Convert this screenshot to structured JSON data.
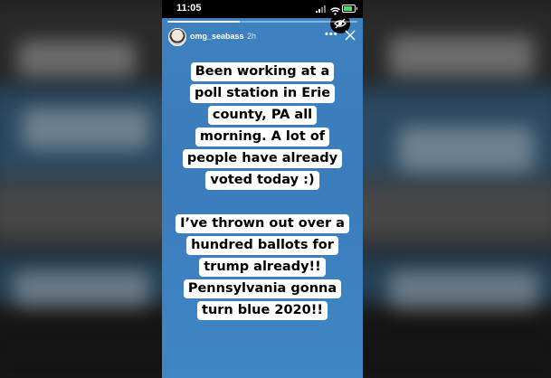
{
  "status_bar": {
    "time": "11:05"
  },
  "story": {
    "username": "omg_seabass",
    "age": "2h",
    "more_label": "•••",
    "progress_fraction": 0.38,
    "paragraphs": [
      {
        "lines": [
          "Been working at a",
          "poll station in Erie",
          "county, PA all",
          "morning. A lot of",
          "people have already",
          "voted today :)"
        ]
      },
      {
        "lines": [
          "I’ve thrown out over a",
          "hundred ballots for",
          "trump already!!",
          "Pennsylvania gonna",
          "turn blue 2020!!"
        ]
      }
    ]
  },
  "colors": {
    "story_background": "#3e82c2",
    "text_highlight": "#ffffff"
  },
  "icons": [
    "eye-slash-icon",
    "close-icon",
    "more-icon",
    "wifi-icon",
    "battery-icon",
    "signal-icon"
  ]
}
